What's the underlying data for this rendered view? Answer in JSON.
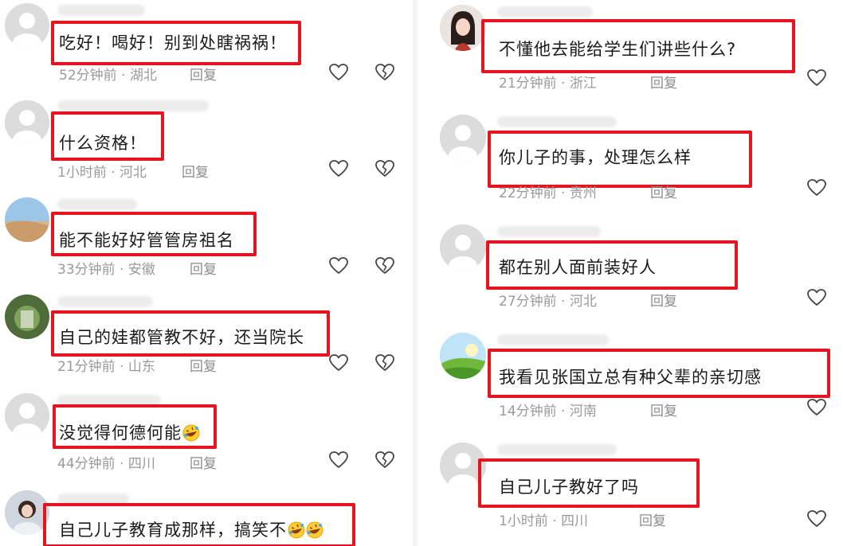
{
  "left_column": {
    "comments": [
      {
        "text": "吃好！喝好！别到处瞎祸祸！",
        "time": "52分钟前",
        "location": "湖北",
        "reply": "回复"
      },
      {
        "text": "什么资格！",
        "time": "1小时前",
        "location": "河北",
        "reply": "回复"
      },
      {
        "text": "能不能好好管管房祖名",
        "time": "33分钟前",
        "location": "安徽",
        "reply": "回复"
      },
      {
        "text": "自己的娃都管教不好，还当院长",
        "time": "21分钟前",
        "location": "山东",
        "reply": "回复"
      },
      {
        "text": "没觉得何德何能",
        "time": "44分钟前",
        "location": "四川",
        "reply": "回复",
        "emoji": "rolling-laughing"
      },
      {
        "text": "自己儿子教育成那样，搞笑不",
        "time": "",
        "location": "",
        "reply": "",
        "emoji": "rolling-laughing-x2"
      }
    ]
  },
  "right_column": {
    "comments": [
      {
        "text": "不懂他去能给学生们讲些什么?",
        "time": "21分钟前",
        "location": "浙江",
        "reply": "回复"
      },
      {
        "text": "你儿子的事，处理怎么样",
        "time": "22分钟前",
        "location": "贵州",
        "reply": "回复"
      },
      {
        "text": "都在别人面前装好人",
        "time": "27分钟前",
        "location": "河北",
        "reply": "回复"
      },
      {
        "text": "我看见张国立总有种父辈的亲切感",
        "time": "14分钟前",
        "location": "河南",
        "reply": "回复"
      },
      {
        "text": "自己儿子教好了吗",
        "time": "1小时前",
        "location": "四川",
        "reply": "回复"
      }
    ]
  },
  "meta_separator": "·",
  "icons": {
    "like": "heart-outline-icon",
    "dislike": "broken-heart-icon"
  },
  "colors": {
    "highlight": "#e4151f",
    "text": "#1b1b1b",
    "meta": "#9a9a9a"
  }
}
